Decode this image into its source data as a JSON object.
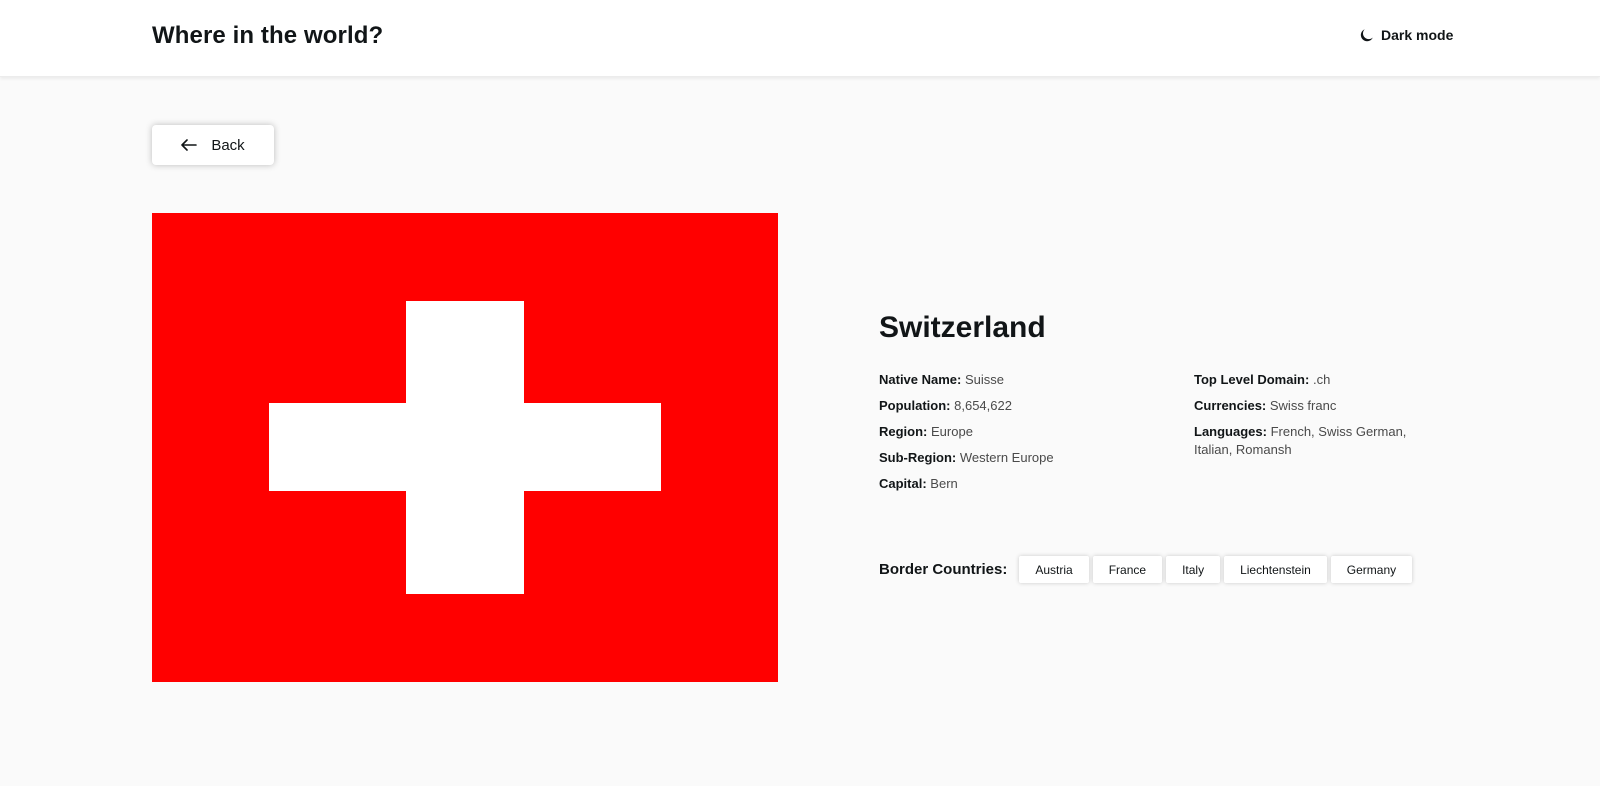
{
  "header": {
    "title": "Where in the world?",
    "theme_toggle_label": "Dark mode",
    "theme_icon": "moon-icon"
  },
  "back_button": {
    "label": "Back",
    "icon": "arrow-left-icon"
  },
  "country": {
    "name": "Switzerland",
    "flag": {
      "description_colors": {
        "background": "#ff0000",
        "cross": "#ffffff"
      }
    },
    "details_left": [
      {
        "label": "Native Name:",
        "value": "Suisse"
      },
      {
        "label": "Population:",
        "value": "8,654,622"
      },
      {
        "label": "Region:",
        "value": "Europe"
      },
      {
        "label": "Sub-Region:",
        "value": "Western Europe"
      },
      {
        "label": "Capital:",
        "value": "Bern"
      }
    ],
    "details_right": [
      {
        "label": "Top Level Domain:",
        "value": ".ch"
      },
      {
        "label": "Currencies:",
        "value": "Swiss franc"
      },
      {
        "label": "Languages:",
        "value": "French, Swiss German, Italian, Romansh"
      }
    ],
    "border_countries_label": "Border Countries:",
    "border_countries": [
      "Austria",
      "France",
      "Italy",
      "Liechtenstein",
      "Germany"
    ]
  },
  "colors": {
    "page_bg": "#fafafa",
    "header_bg": "#ffffff",
    "text": "#111517"
  }
}
